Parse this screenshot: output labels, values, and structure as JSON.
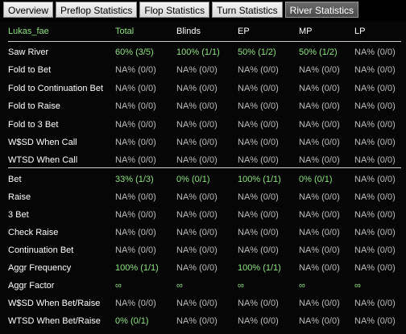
{
  "tabs": [
    "Overview",
    "Preflop Statistics",
    "Flop Statistics",
    "Turn Statistics",
    "River Statistics"
  ],
  "active_tab": 4,
  "table": {
    "headers": [
      "Lukas_fae",
      "Total",
      "Blinds",
      "EP",
      "MP",
      "LP"
    ],
    "rows": [
      [
        "Saw River",
        "60% (3/5)",
        "100% (1/1)",
        "50% (1/2)",
        "50% (1/2)",
        "NA% (0/0)"
      ],
      [
        "Fold to Bet",
        "NA% (0/0)",
        "NA% (0/0)",
        "NA% (0/0)",
        "NA% (0/0)",
        "NA% (0/0)"
      ],
      [
        "Fold to Continuation Bet",
        "NA% (0/0)",
        "NA% (0/0)",
        "NA% (0/0)",
        "NA% (0/0)",
        "NA% (0/0)"
      ],
      [
        "Fold to Raise",
        "NA% (0/0)",
        "NA% (0/0)",
        "NA% (0/0)",
        "NA% (0/0)",
        "NA% (0/0)"
      ],
      [
        "Fold to 3 Bet",
        "NA% (0/0)",
        "NA% (0/0)",
        "NA% (0/0)",
        "NA% (0/0)",
        "NA% (0/0)"
      ],
      [
        "W$SD When Call",
        "NA% (0/0)",
        "NA% (0/0)",
        "NA% (0/0)",
        "NA% (0/0)",
        "NA% (0/0)"
      ],
      [
        "WTSD When Call",
        "NA% (0/0)",
        "NA% (0/0)",
        "NA% (0/0)",
        "NA% (0/0)",
        "NA% (0/0)"
      ],
      [
        "Bet",
        "33% (1/3)",
        "0% (0/1)",
        "100% (1/1)",
        "0% (0/1)",
        "NA% (0/0)"
      ],
      [
        "Raise",
        "NA% (0/0)",
        "NA% (0/0)",
        "NA% (0/0)",
        "NA% (0/0)",
        "NA% (0/0)"
      ],
      [
        "3 Bet",
        "NA% (0/0)",
        "NA% (0/0)",
        "NA% (0/0)",
        "NA% (0/0)",
        "NA% (0/0)"
      ],
      [
        "Check Raise",
        "NA% (0/0)",
        "NA% (0/0)",
        "NA% (0/0)",
        "NA% (0/0)",
        "NA% (0/0)"
      ],
      [
        "Continuation Bet",
        "NA% (0/0)",
        "NA% (0/0)",
        "NA% (0/0)",
        "NA% (0/0)",
        "NA% (0/0)"
      ],
      [
        "Aggr Frequency",
        "100% (1/1)",
        "NA% (0/0)",
        "100% (1/1)",
        "NA% (0/0)",
        "NA% (0/0)"
      ],
      [
        "Aggr Factor",
        "∞",
        "∞",
        "∞",
        "∞",
        "∞"
      ],
      [
        "W$SD When Bet/Raise",
        "NA% (0/0)",
        "NA% (0/0)",
        "NA% (0/0)",
        "NA% (0/0)",
        "NA% (0/0)"
      ],
      [
        "WTSD When Bet/Raise",
        "0% (0/1)",
        "NA% (0/0)",
        "NA% (0/0)",
        "NA% (0/0)",
        "NA% (0/0)"
      ]
    ]
  }
}
